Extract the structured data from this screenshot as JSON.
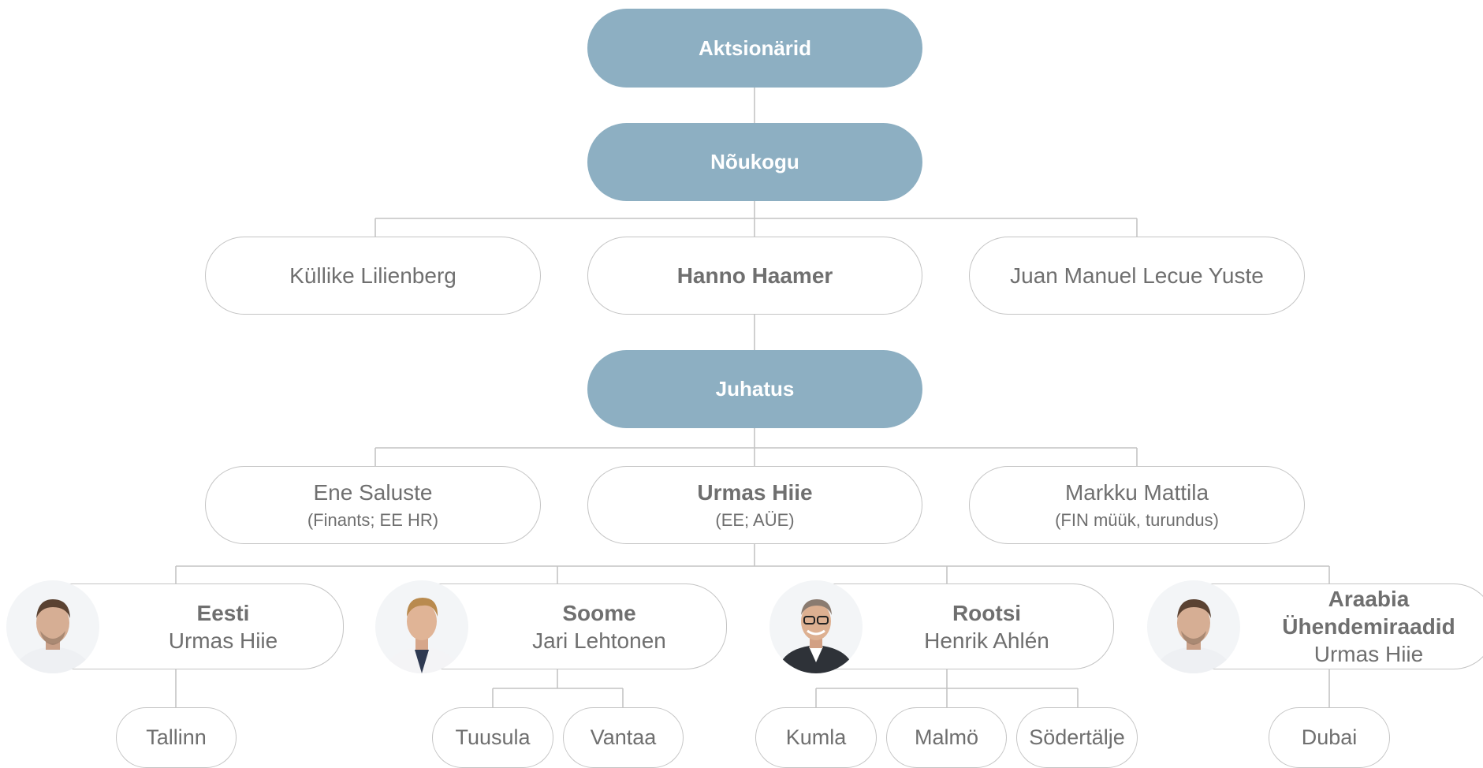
{
  "colors": {
    "filled_node": "#8dafc2",
    "outline_border": "#c4c4c4",
    "connector_line": "#c4c4c4",
    "text_gray": "#6f6f6f"
  },
  "shareholders": {
    "label": "Aktsionärid"
  },
  "council": {
    "label": "Nõukogu",
    "members": [
      "Küllike Lilienberg",
      "Hanno Haamer",
      "Juan Manuel Lecue Yuste"
    ]
  },
  "board": {
    "label": "Juhatus",
    "members": [
      {
        "name": "Ene Saluste",
        "role": "(Finants; EE HR)"
      },
      {
        "name": "Urmas Hiie",
        "role": "(EE; AÜE)"
      },
      {
        "name": "Markku Mattila",
        "role": "(FIN müük, turundus)"
      }
    ]
  },
  "regions": [
    {
      "title": "Eesti",
      "manager": "Urmas Hiie",
      "photo": "manager-photo",
      "cities": [
        "Tallinn"
      ]
    },
    {
      "title": "Soome",
      "manager": "Jari Lehtonen",
      "photo": "manager-photo",
      "cities": [
        "Tuusula",
        "Vantaa"
      ]
    },
    {
      "title": "Rootsi",
      "manager": "Henrik Ahlén",
      "photo": "manager-photo",
      "cities": [
        "Kumla",
        "Malmö",
        "Södertälje"
      ]
    },
    {
      "title": "Araabia Ühendemiraadid",
      "manager": "Urmas Hiie",
      "photo": "manager-photo",
      "cities": [
        "Dubai"
      ]
    }
  ]
}
